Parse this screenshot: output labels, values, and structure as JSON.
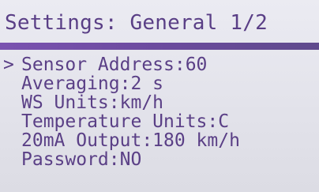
{
  "header": {
    "title": "Settings: General 1/2"
  },
  "menu": {
    "cursor_glyph": ">",
    "selected_index": 0,
    "items": [
      {
        "label": "Sensor Address:60"
      },
      {
        "label": "Averaging:2 s"
      },
      {
        "label": "WS Units:km/h"
      },
      {
        "label": "Temperature Units:C"
      },
      {
        "label": "20mA Output:180 km/h"
      },
      {
        "label": "Password:NO"
      }
    ]
  },
  "colors": {
    "text": "#5a3f86",
    "background": "#e4e4ec",
    "divider": "#6a4a9c"
  }
}
